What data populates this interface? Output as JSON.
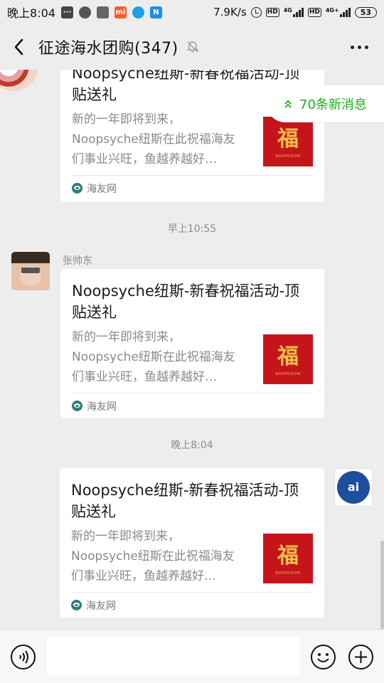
{
  "status_bar": {
    "time": "晚上8:04",
    "net_speed": "7.9K/s",
    "hd1": "HD",
    "hd2": "HD",
    "net1": "4G",
    "net2": "4G+",
    "battery": "53",
    "app_icons": [
      "chat-bubble-icon",
      "wechat-icon",
      "notification-icon",
      "mi-icon",
      "browser-icon",
      "n-app-icon"
    ]
  },
  "header": {
    "title": "征途海水团购(347)",
    "mute_icon": "bell-muted-icon",
    "more_icon": "more-icon"
  },
  "new_messages": {
    "label": "70条新消息",
    "color": "#1aad19"
  },
  "messages": [
    {
      "title": "Noopsyche纽斯-新春祝福活动-顶贴送礼",
      "desc": "新的一年即将到来，Noopsyche纽斯在此祝福海友们事业兴旺，鱼越养越好…",
      "source": "海友网"
    },
    {
      "timestamp": "早上10:55",
      "sender": "张帅东",
      "title": "Noopsyche纽斯-新春祝福活动-顶贴送礼",
      "desc": "新的一年即将到来，Noopsyche纽斯在此祝福海友们事业兴旺，鱼越养越好…",
      "source": "海友网"
    },
    {
      "timestamp": "晚上8:04",
      "title": "Noopsyche纽斯-新春祝福活动-顶贴送礼",
      "desc": "新的一年即将到来，Noopsyche纽斯在此祝福海友们事业兴旺，鱼越养越好…",
      "source": "海友网"
    }
  ],
  "thumb": {
    "glyph": "福",
    "caption": "NOOPSYCHE"
  },
  "input_bar": {
    "voice_icon": "voice-icon",
    "emoji_icon": "emoji-icon",
    "plus_icon": "plus-icon"
  }
}
